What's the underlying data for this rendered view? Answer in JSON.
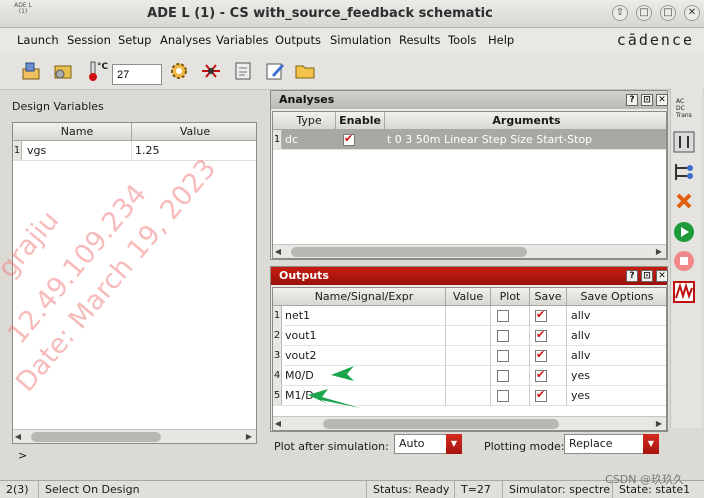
{
  "window": {
    "app_logo": "ADE L (1)",
    "title": "ADE L (1) - CS with_source_feedback schematic",
    "buttons": [
      "⇧",
      "□",
      "□",
      "✕"
    ]
  },
  "menu": {
    "items": [
      "Launch",
      "Session",
      "Setup",
      "Analyses",
      "Variables",
      "Outputs",
      "Simulation",
      "Results",
      "Tools",
      "Help"
    ],
    "brand": "cādence"
  },
  "toolbar": {
    "temp_unit": "°C",
    "temperature": "27"
  },
  "design_variables": {
    "label": "Design Variables",
    "columns": [
      "Name",
      "Value"
    ],
    "rows": [
      {
        "num": "1",
        "name": "vgs",
        "value": "1.25"
      }
    ]
  },
  "prompt": ">",
  "analyses": {
    "title": "Analyses",
    "columns": [
      "Type",
      "Enable",
      "Arguments"
    ],
    "rows": [
      {
        "num": "1",
        "type": "dc",
        "enabled": true,
        "arguments": "t 0 3 50m Linear Step Size Start-Stop"
      }
    ]
  },
  "outputs": {
    "title": "Outputs",
    "columns": [
      "Name/Signal/Expr",
      "Value",
      "Plot",
      "Save",
      "Save Options"
    ],
    "rows": [
      {
        "num": "1",
        "name": "net1",
        "value": "",
        "plot": false,
        "save": true,
        "save_options": "allv"
      },
      {
        "num": "2",
        "name": "vout1",
        "value": "",
        "plot": false,
        "save": true,
        "save_options": "allv"
      },
      {
        "num": "3",
        "name": "vout2",
        "value": "",
        "plot": false,
        "save": true,
        "save_options": "allv"
      },
      {
        "num": "4",
        "name": "M0/D",
        "value": "",
        "plot": false,
        "save": true,
        "save_options": "yes"
      },
      {
        "num": "5",
        "name": "M1/D",
        "value": "",
        "plot": false,
        "save": true,
        "save_options": "yes"
      }
    ]
  },
  "options": {
    "plot_after_label": "Plot after simulation:",
    "plot_after_value": "Auto",
    "plotting_mode_label": "Plotting mode:",
    "plotting_mode_value": "Replace"
  },
  "right_toolbar": {
    "mini_labels": [
      "AC",
      "DC",
      "Trans"
    ]
  },
  "status": {
    "count": "2(3)",
    "message": "Select On Design",
    "status": "Status: Ready",
    "temp": "T=27 C",
    "simulator": "Simulator: spectre",
    "state": "State: state1"
  },
  "watermark": {
    "lines": [
      "grajiu",
      "12.49.109.234",
      "Date: March 19, 2023"
    ],
    "csdn": "CSDN @玖玖久"
  },
  "colors": {
    "accent_red": "#b5160e",
    "selection": "#a9a8a4",
    "check_red": "#d01010",
    "annotation_arrow": "#1ba44a"
  }
}
